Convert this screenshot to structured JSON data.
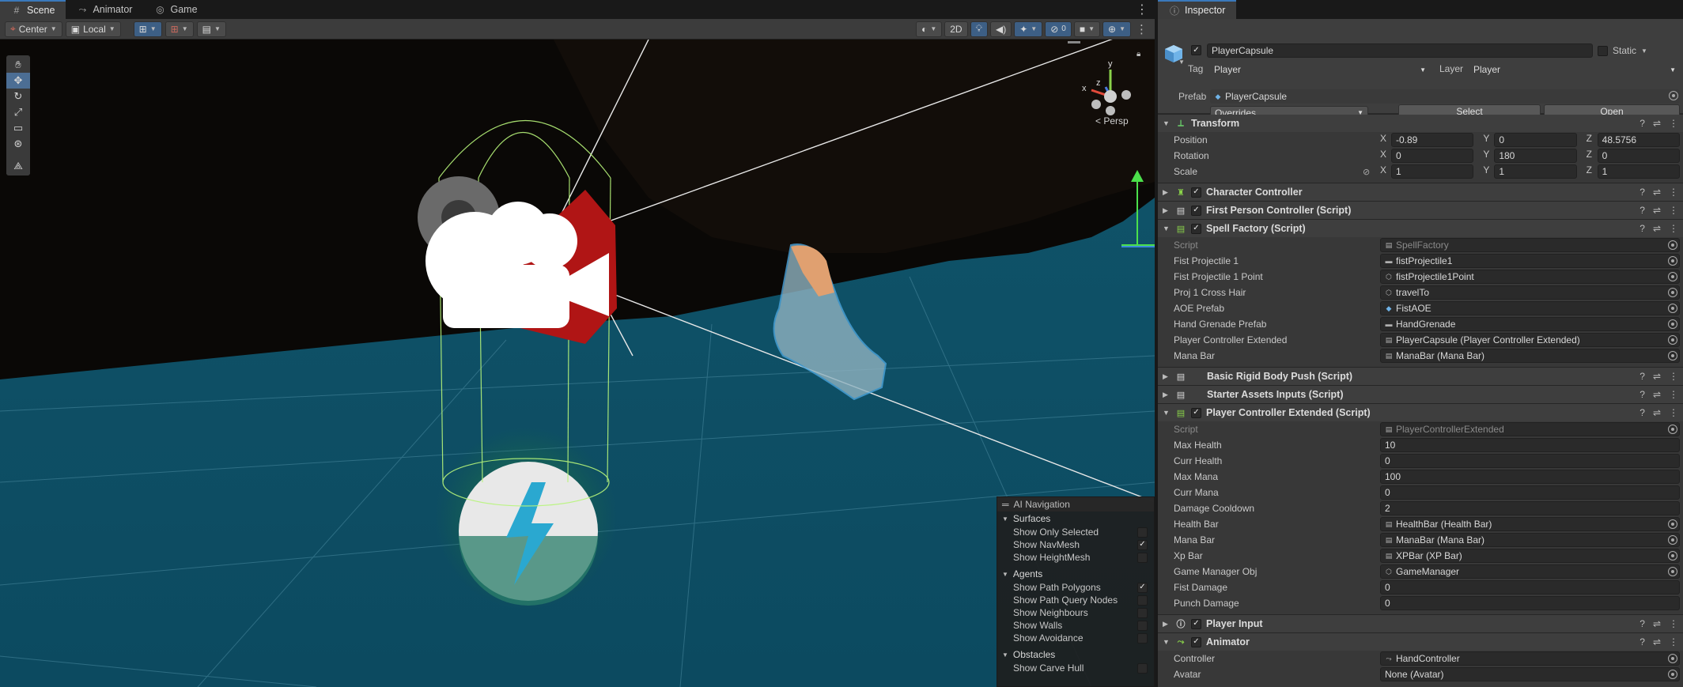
{
  "scene_panel": {
    "tabs": [
      {
        "label": "Scene",
        "icon": "grid-icon"
      },
      {
        "label": "Animator",
        "icon": "animator-icon"
      },
      {
        "label": "Game",
        "icon": "gamepad-icon"
      }
    ],
    "toolbar": {
      "pivot_label": "Center",
      "space_label": "Local",
      "view_2d_label": "2D"
    },
    "view_label": "Persp",
    "gizmo_axes": {
      "x": "x",
      "y": "y",
      "z": "z"
    }
  },
  "ai_navigation": {
    "title": "AI Navigation",
    "sections": [
      {
        "label": "Surfaces",
        "items": [
          {
            "label": "Show Only Selected",
            "checked": false
          },
          {
            "label": "Show NavMesh",
            "checked": true
          },
          {
            "label": "Show HeightMesh",
            "checked": false
          }
        ]
      },
      {
        "label": "Agents",
        "items": [
          {
            "label": "Show Path Polygons",
            "checked": true
          },
          {
            "label": "Show Path Query Nodes",
            "checked": false
          },
          {
            "label": "Show Neighbours",
            "checked": false
          },
          {
            "label": "Show Walls",
            "checked": false
          },
          {
            "label": "Show Avoidance",
            "checked": false
          }
        ]
      },
      {
        "label": "Obstacles",
        "items": [
          {
            "label": "Show Carve Hull",
            "checked": false
          }
        ]
      }
    ]
  },
  "inspector": {
    "tab_label": "Inspector",
    "object": {
      "name": "PlayerCapsule",
      "static_label": "Static",
      "tag_label": "Tag",
      "tag_value": "Player",
      "layer_label": "Layer",
      "layer_value": "Player",
      "prefab_label": "Prefab",
      "prefab_value": "PlayerCapsule",
      "overrides_label": "Overrides",
      "select_label": "Select",
      "open_label": "Open"
    },
    "transform": {
      "title": "Transform",
      "position": {
        "label": "Position",
        "x": "-0.89",
        "y": "0",
        "z": "48.5756"
      },
      "rotation": {
        "label": "Rotation",
        "x": "0",
        "y": "180",
        "z": "0"
      },
      "scale": {
        "label": "Scale",
        "x": "1",
        "y": "1",
        "z": "1"
      }
    },
    "character_controller": {
      "title": "Character Controller"
    },
    "first_person_controller": {
      "title": "First Person Controller (Script)"
    },
    "spell_factory": {
      "title": "Spell Factory (Script)",
      "props": [
        {
          "label": "Script",
          "value": "SpellFactory",
          "icon": "script-icon",
          "disabled": true
        },
        {
          "label": "Fist Projectile 1",
          "value": "fistProjectile1",
          "icon": "prefab-icon"
        },
        {
          "label": "Fist Projectile 1 Point",
          "value": "fistProjectile1Point",
          "icon": "gameobject-icon"
        },
        {
          "label": "Proj 1 Cross Hair",
          "value": "travelTo",
          "icon": "gameobject-icon"
        },
        {
          "label": "AOE Prefab",
          "value": "FistAOE",
          "icon": "prefab-icon"
        },
        {
          "label": "Hand Grenade Prefab",
          "value": "HandGrenade",
          "icon": "prefab-icon"
        },
        {
          "label": "Player Controller Extended",
          "value": "PlayerCapsule (Player Controller Extended)",
          "icon": "script-icon"
        },
        {
          "label": "Mana Bar",
          "value": "ManaBar (Mana Bar)",
          "icon": "script-icon"
        }
      ]
    },
    "basic_rigid_body_push": {
      "title": "Basic Rigid Body Push (Script)"
    },
    "starter_assets_inputs": {
      "title": "Starter Assets Inputs (Script)"
    },
    "player_controller_extended": {
      "title": "Player Controller Extended (Script)",
      "script": {
        "label": "Script",
        "value": "PlayerControllerExtended"
      },
      "numeric_props": [
        {
          "label": "Max Health",
          "value": "10"
        },
        {
          "label": "Curr Health",
          "value": "0"
        },
        {
          "label": "Max Mana",
          "value": "100"
        },
        {
          "label": "Curr Mana",
          "value": "0"
        },
        {
          "label": "Damage Cooldown",
          "value": "2"
        }
      ],
      "ref_props": [
        {
          "label": "Health Bar",
          "value": "HealthBar (Health Bar)",
          "icon": "script-icon"
        },
        {
          "label": "Mana Bar",
          "value": "ManaBar (Mana Bar)",
          "icon": "script-icon"
        },
        {
          "label": "Xp Bar",
          "value": "XPBar (XP Bar)",
          "icon": "script-icon"
        },
        {
          "label": "Game Manager Obj",
          "value": "GameManager",
          "icon": "gameobject-icon"
        }
      ],
      "tail_props": [
        {
          "label": "Fist Damage",
          "value": "0"
        },
        {
          "label": "Punch Damage",
          "value": "0"
        }
      ]
    },
    "player_input": {
      "title": "Player Input"
    },
    "animator": {
      "title": "Animator",
      "controller": {
        "label": "Controller",
        "value": "HandController"
      },
      "avatar": {
        "label": "Avatar",
        "value": "None (Avatar)"
      }
    }
  }
}
